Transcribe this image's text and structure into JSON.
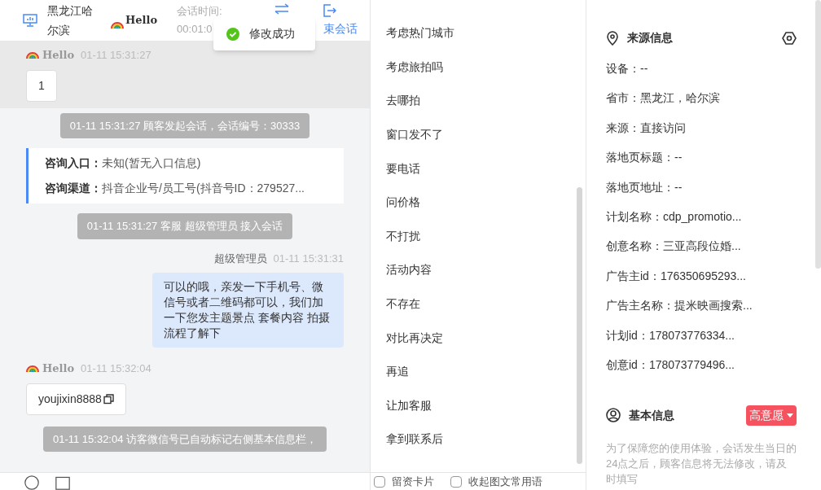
{
  "header": {
    "location": "黑龙江哈尔滨",
    "nickname": "Hello",
    "time_label": "会话时间:",
    "time_value": "00:01:0",
    "end_button": "束会话"
  },
  "toast": {
    "kind": "success",
    "text": "修改成功"
  },
  "messages": [
    {
      "kind": "visitor",
      "name": "Hello",
      "time": "01-11 15:31:27",
      "text": "1",
      "copy": false,
      "highlighted": true
    },
    {
      "kind": "system",
      "text": "01-11 15:31:27 顾客发起会话，会话编号：30333"
    },
    {
      "kind": "info",
      "rows": [
        {
          "label": "咨询入口：",
          "value": "未知(暂无入口信息)"
        },
        {
          "label": "咨询渠道：",
          "value": "抖音企业号/员工号(抖音号ID：279527..."
        }
      ]
    },
    {
      "kind": "system",
      "text": "01-11 15:31:27 客服 超级管理员 接入会话"
    },
    {
      "kind": "agent",
      "name": "超级管理员",
      "time": "01-11 15:31:31",
      "text": "可以的哦，亲发一下手机号、微信号或者二维码都可以，我们加一下您发主题景点 套餐内容 拍摄流程了解下"
    },
    {
      "kind": "visitor",
      "name": "Hello",
      "time": "01-11 15:32:04",
      "text": "youjixin8888",
      "copy": true,
      "highlighted": false
    },
    {
      "kind": "system",
      "text": "01-11 15:32:04 访客微信号已自动标记右侧基本信息栏，"
    }
  ],
  "bottom_options": [
    {
      "label": "留资卡片",
      "checked": false
    },
    {
      "label": "收起图文常用语",
      "checked": false
    }
  ],
  "phrases": [
    "考虑热门城市",
    "考虑旅拍吗",
    "去哪拍",
    "窗口发不了",
    "要电话",
    "问价格",
    "不打扰",
    "活动内容",
    "不存在",
    "对比再决定",
    "再追",
    "让加客服",
    "拿到联系后"
  ],
  "source_info": {
    "title": "来源信息",
    "rows": [
      "设备：--",
      "省市：黑龙江，哈尔滨",
      "来源：直接访问",
      "落地页标题：--",
      "落地页地址：--",
      "计划名称：cdp_promotio...",
      "创意名称：三亚高段位婚...",
      "广告主id：176350695293...",
      "广告主名称：提米映画搜索...",
      "计划id：178073776334...",
      "创意id：178073779496..."
    ]
  },
  "basic_info": {
    "title": "基本信息",
    "intent_tag": "高意愿",
    "notice": "为了保障您的使用体验，会话发生当日的24点之后，顾客信息将无法修改，请及时填写"
  }
}
